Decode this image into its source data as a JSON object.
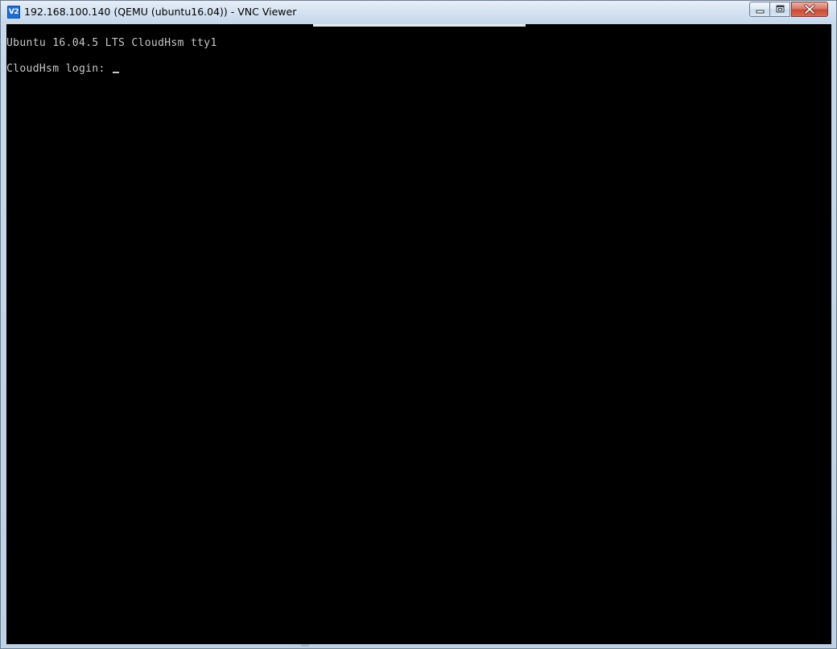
{
  "window": {
    "title": "192.168.100.140 (QEMU (ubuntu16.04)) - VNC Viewer",
    "icon_name": "vnc-viewer-icon",
    "icon_text": "V2",
    "controls": {
      "minimize": "minimize-icon",
      "restore": "restore-icon",
      "close": "close-icon"
    }
  },
  "terminal": {
    "lines": [
      "Ubuntu 16.04.5 LTS CloudHsm tty1",
      "CloudHsm login: "
    ],
    "background": "#000000",
    "foreground": "#c8c8c8"
  }
}
